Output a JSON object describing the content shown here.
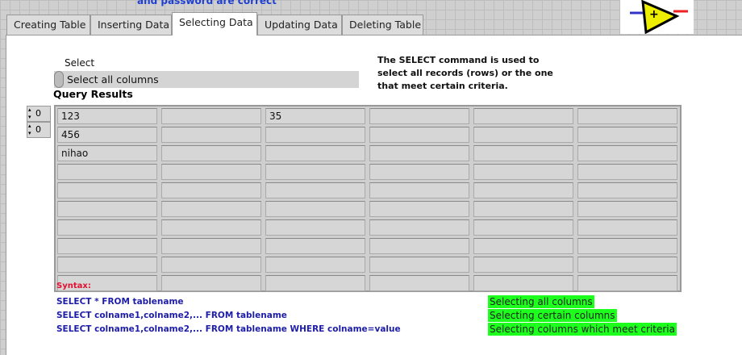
{
  "header_text": "and password are correct",
  "tabs": [
    "Creating Table",
    "Inserting Data",
    "Selecting Data",
    "Updating Data",
    "Deleting Table"
  ],
  "active_tab": "Selecting Data",
  "select": {
    "label": "Select",
    "value": "Select all columns"
  },
  "description": "The SELECT command is used to select all records (rows) or the one that meet certain criteria.",
  "query_results": {
    "title": "Query Results",
    "row_index": "0",
    "col_index": "0",
    "rows": [
      [
        "123",
        "",
        "35",
        "",
        "",
        "",
        ""
      ],
      [
        "456",
        "",
        "",
        "",
        "",
        "",
        ""
      ],
      [
        "nihao",
        "",
        "",
        "",
        "",
        "",
        ""
      ],
      [
        "",
        "",
        "",
        "",
        "",
        "",
        ""
      ],
      [
        "",
        "",
        "",
        "",
        "",
        "",
        ""
      ],
      [
        "",
        "",
        "",
        "",
        "",
        "",
        ""
      ],
      [
        "",
        "",
        "",
        "",
        "",
        "",
        ""
      ],
      [
        "",
        "",
        "",
        "",
        "",
        "",
        ""
      ],
      [
        "",
        "",
        "",
        "",
        "",
        "",
        ""
      ],
      [
        "",
        "",
        "",
        "",
        "",
        "",
        ""
      ]
    ]
  },
  "syntax": {
    "label": "Syntax:",
    "lines": [
      "SELECT * FROM tablename",
      "SELECT colname1,colname2,... FROM tablename",
      "SELECT colname1,colname2,... FROM tablename WHERE colname=value"
    ],
    "notes": [
      "Selecting all columns",
      "Selecting certain columns",
      "Selecting columns which meet criteria"
    ]
  }
}
